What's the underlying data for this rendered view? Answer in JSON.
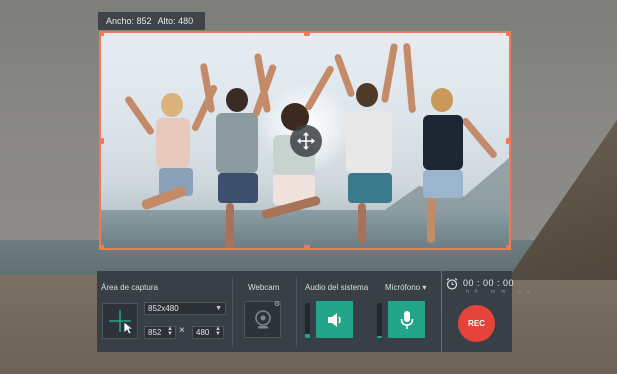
{
  "dimensions": {
    "width_label": "Ancho: 852",
    "height_label": "Alto: 480"
  },
  "capture_area": {
    "title": "Área de captura",
    "preset": "852x480",
    "width_value": "852",
    "height_value": "480",
    "times_symbol": "×"
  },
  "webcam": {
    "title": "Webcam"
  },
  "system_audio": {
    "title": "Audio del sistema",
    "level": 0.12
  },
  "microphone": {
    "title": "Micrófono ▾",
    "level": 0.06
  },
  "timer": {
    "value": "00 : 00 : 00",
    "units": "hh mm ss"
  },
  "rec_button": {
    "label": "REC"
  },
  "colors": {
    "accent": "#ef7a55",
    "panel": "#393f46",
    "toggle_on": "#23a58a",
    "rec": "#e6433a"
  },
  "icons": [
    "move-icon",
    "crosshair-icon",
    "cursor-icon",
    "webcam-icon",
    "gear-icon",
    "speaker-icon",
    "microphone-icon",
    "alarm-icon"
  ]
}
